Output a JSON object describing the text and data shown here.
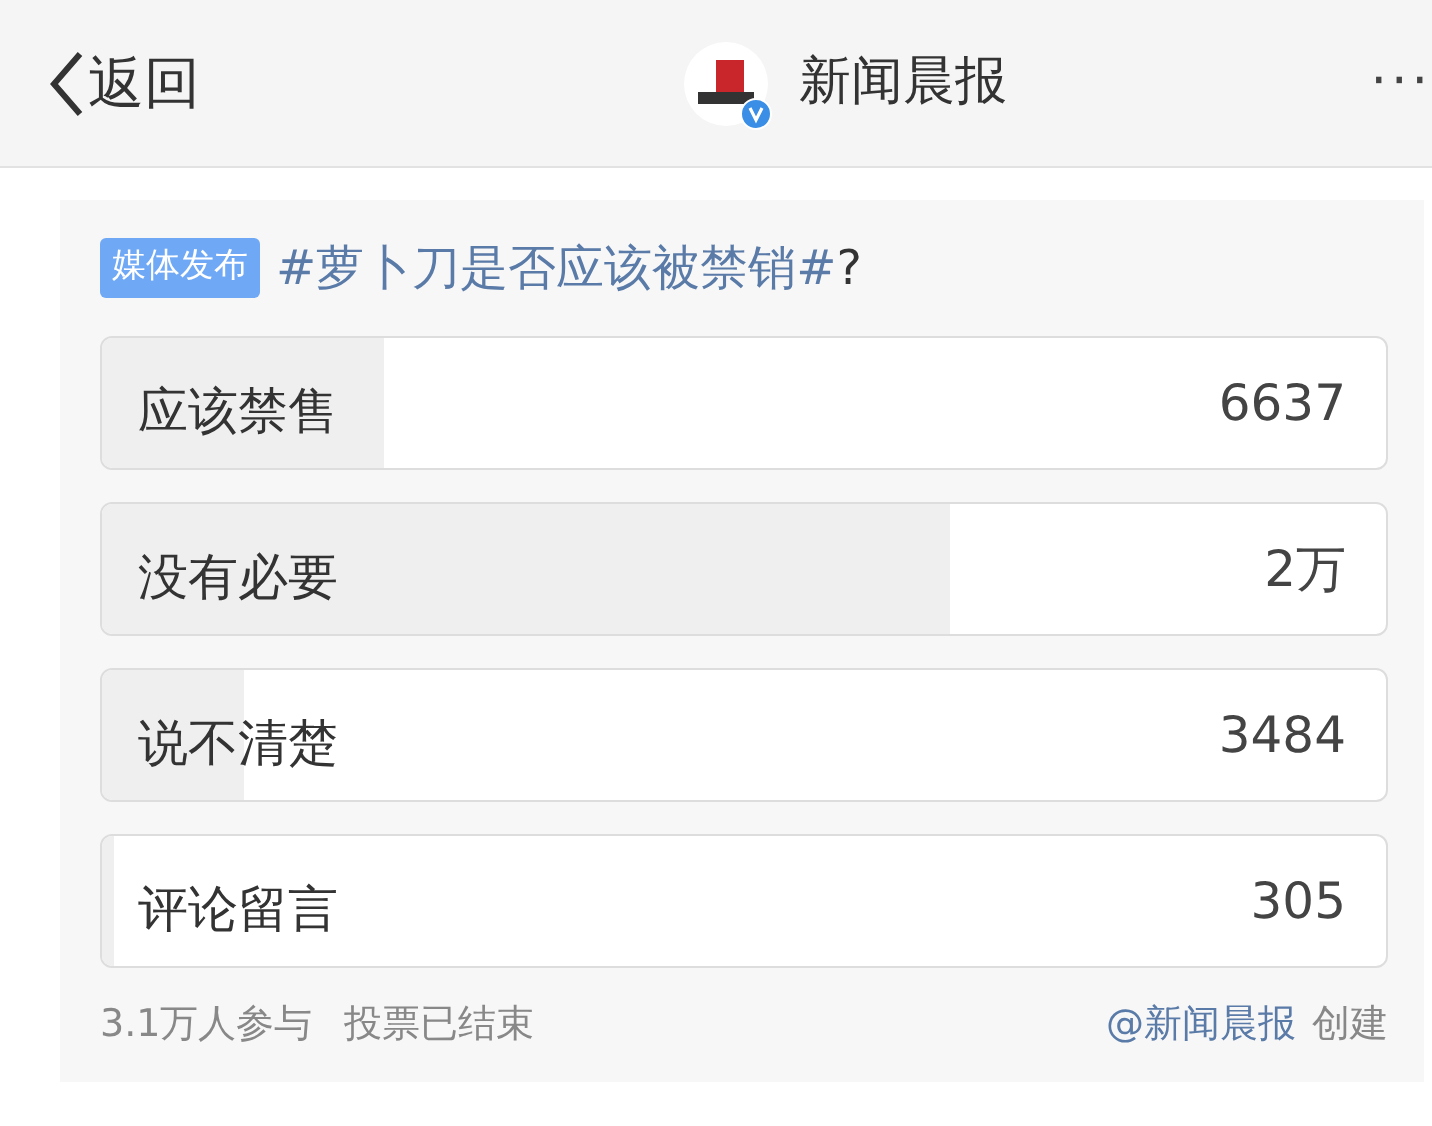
{
  "header": {
    "back_label": "返回",
    "account_name": "新闻晨报",
    "verified": true,
    "more": "···"
  },
  "poll": {
    "tag": "媒体发布",
    "topic": "#萝卜刀是否应该被禁销#",
    "suffix": "?",
    "options": [
      {
        "label": "应该禁售",
        "count": "6637",
        "level": 0.22
      },
      {
        "label": "没有必要",
        "count": "2万",
        "level": 0.66
      },
      {
        "label": "说不清楚",
        "count": "3484",
        "level": 0.11
      },
      {
        "label": "评论留言",
        "count": "305",
        "level": 0.01
      }
    ],
    "participants": "3.1万人参与",
    "status": "投票已结束",
    "creator": "@新闻晨报",
    "created_label": "创建"
  }
}
